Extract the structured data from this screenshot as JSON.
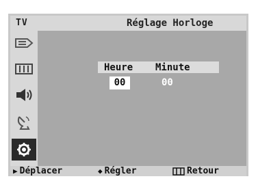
{
  "header": {
    "source": "TV",
    "title": "Réglage Horloge"
  },
  "sidebar": {
    "items": [
      {
        "icon": "input-source-icon"
      },
      {
        "icon": "picture-icon"
      },
      {
        "icon": "sound-icon"
      },
      {
        "icon": "antenna-icon"
      },
      {
        "icon": "setup-gear-icon",
        "selected": true
      }
    ]
  },
  "clock": {
    "hour_label": "Heure",
    "minute_label": "Minute",
    "hour_value": "00",
    "minute_value": "00"
  },
  "footer": {
    "move": {
      "icon": "right-triangle-icon",
      "label": "Déplacer"
    },
    "adjust": {
      "icon": "up-down-icon",
      "label": "Régler"
    },
    "return": {
      "icon": "menu-icon",
      "label": "Retour"
    }
  },
  "colors": {
    "panel": "#a8a8a8",
    "sidebar": "#d8d8d8",
    "selected": "#2a2a2a"
  }
}
